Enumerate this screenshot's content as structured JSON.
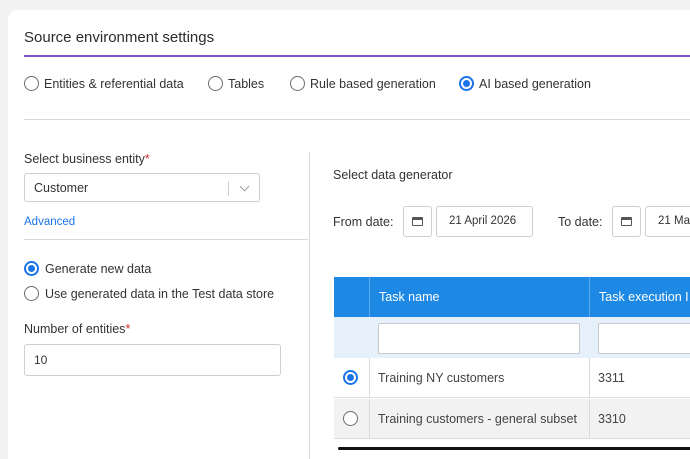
{
  "header": {
    "title": "Source environment settings"
  },
  "source_types": [
    {
      "label": "Entities & referential data",
      "selected": false
    },
    {
      "label": "Tables",
      "selected": false
    },
    {
      "label": "Rule based generation",
      "selected": false
    },
    {
      "label": "AI based generation",
      "selected": true
    }
  ],
  "left": {
    "business_entity_label": "Select business entity",
    "required_mark": "*",
    "business_entity_value": "Customer",
    "advanced_link": "Advanced",
    "generation_options": [
      {
        "label": "Generate new data",
        "selected": true
      },
      {
        "label": "Use generated data in the Test data store",
        "selected": false
      }
    ],
    "entities_label": "Number of entities",
    "entities_value": "10"
  },
  "right": {
    "generator_label": "Select data generator",
    "from_label": "From date:",
    "from_value": "21 April 2026",
    "to_label": "To date:",
    "to_value": "21 Ma"
  },
  "table": {
    "columns": [
      "Task name",
      "Task execution I"
    ],
    "rows": [
      {
        "selected": true,
        "task_name": "Training NY customers",
        "execution_id": "3311"
      },
      {
        "selected": false,
        "task_name": "Training customers - general subset",
        "execution_id": "3310"
      }
    ]
  },
  "colors": {
    "accent_purple": "#7d55c7",
    "primary_blue": "#1e88e5",
    "required_red": "#d32f2f"
  }
}
